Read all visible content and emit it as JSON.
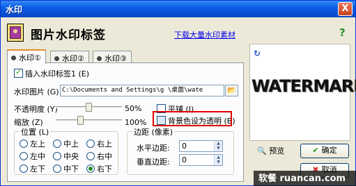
{
  "window": {
    "title": "水印",
    "close_glyph": "X"
  },
  "header": {
    "title": "图片水印标签",
    "download_link": "下载大量水印素材",
    "help_glyph": "?"
  },
  "tabs": [
    {
      "label": "水印①",
      "active": true
    },
    {
      "label": "水印②",
      "active": false
    },
    {
      "label": "水印③",
      "active": false
    }
  ],
  "form": {
    "insert_label": "插入水印标签1 (E)",
    "insert_checked": true,
    "image_label": "水印图片 (G):",
    "image_path": "C:\\Documents and Settings\\g      \\桌面\\wate",
    "browse_glyph": "📂",
    "opacity_label": "不透明度 (Y)",
    "opacity_value": "50%",
    "opacity_fraction": 0.5,
    "scale_label": "缩放 (Z)",
    "scale_value": "100%",
    "scale_fraction": 0.36,
    "tile_label": "平铺 (I)",
    "tile_checked": false,
    "transparent_bg_label": "背景色设为透明 (B)",
    "transparent_bg_checked": false
  },
  "position": {
    "title": "位置 (L)",
    "options": [
      "左上",
      "中上",
      "右上",
      "左中",
      "中央",
      "右中",
      "左下",
      "中下",
      "右下"
    ],
    "selected": "右下"
  },
  "margins": {
    "title": "边距 (像素)",
    "horizontal_label": "水平边距:",
    "horizontal_value": "0",
    "vertical_label": "垂直边距:",
    "vertical_value": "0"
  },
  "preview": {
    "refresh_glyph": "↻",
    "sample_text": "WATERMARK"
  },
  "buttons": {
    "preview": "预览",
    "ok": "确定",
    "cancel": "取消"
  },
  "site_watermark": "软餐 ruancan.com",
  "colors": {
    "title_bar": "#0a5de6",
    "highlight": "#e00000",
    "link": "#0000ee"
  }
}
